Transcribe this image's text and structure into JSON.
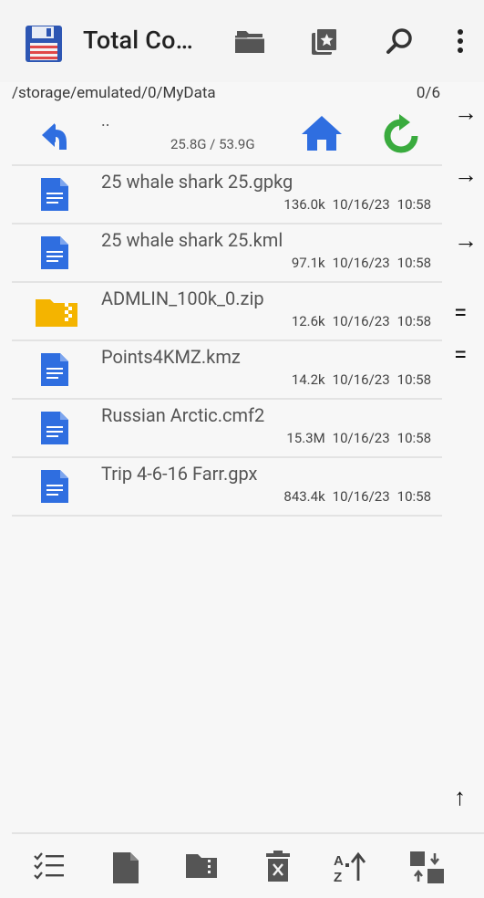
{
  "app": {
    "title": "Total Co…",
    "icons": [
      "floppy-disk-icon",
      "folder-stack-icon",
      "bookmark-star-icon",
      "search-icon",
      "more-vert-icon"
    ]
  },
  "path": {
    "text": "/storage/emulated/0/MyData",
    "count": "0/6"
  },
  "updir": {
    "label": "..",
    "space": "25.8G / 53.9G"
  },
  "files": [
    {
      "name": "25 whale shark 25.gpkg",
      "size": "136.0k",
      "date": "10/16/23",
      "time": "10:58",
      "icon": "document-icon"
    },
    {
      "name": "25 whale shark 25.kml",
      "size": "97.1k",
      "date": "10/16/23",
      "time": "10:58",
      "icon": "document-icon"
    },
    {
      "name": "ADMLIN_100k_0.zip",
      "size": "12.6k",
      "date": "10/16/23",
      "time": "10:58",
      "icon": "zip-folder-icon"
    },
    {
      "name": "Points4KMZ.kmz",
      "size": "14.2k",
      "date": "10/16/23",
      "time": "10:58",
      "icon": "document-icon"
    },
    {
      "name": "Russian Arctic.cmf2",
      "size": "15.3M",
      "date": "10/16/23",
      "time": "10:58",
      "icon": "document-icon"
    },
    {
      "name": "Trip 4-6-16 Farr.gpx",
      "size": "843.4k",
      "date": "10/16/23",
      "time": "10:58",
      "icon": "document-icon"
    }
  ],
  "side_panel": {
    "arrows": [
      "→",
      "→",
      "→",
      "=",
      "=",
      "↑"
    ]
  },
  "colors": {
    "blue": "#2f6ee0",
    "green": "#3aab3e",
    "folder": "#f4b400",
    "doc": "#2f6ee0"
  }
}
